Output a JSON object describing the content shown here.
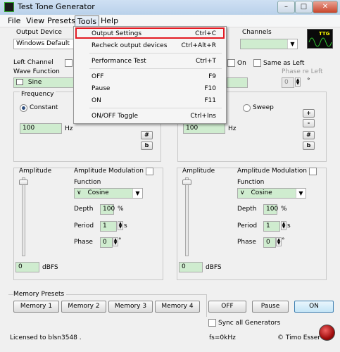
{
  "window": {
    "title": "Test Tone Generator"
  },
  "menu": {
    "file": "File",
    "view": "View",
    "presets": "Presets",
    "tools": "Tools",
    "help": "Help"
  },
  "tools_menu": [
    {
      "label": "Output Settings",
      "shortcut": "Ctrl+C"
    },
    {
      "label": "Recheck output devices",
      "shortcut": "Ctrl+Alt+R"
    },
    {
      "label": "Performance Test",
      "shortcut": "Ctrl+T"
    },
    {
      "label": "OFF",
      "shortcut": "F9"
    },
    {
      "label": "Pause",
      "shortcut": "F10"
    },
    {
      "label": "ON",
      "shortcut": "F11"
    },
    {
      "label": "ON/OFF Toggle",
      "shortcut": "Ctrl+Ins"
    }
  ],
  "output": {
    "device_label": "Output Device",
    "device_value": "Windows Default",
    "channels_label": "Channels"
  },
  "scope_text": "TTG",
  "left": {
    "channel_label": "Left Channel",
    "wave_function_label": "Wave Function",
    "wave_value": "Sine",
    "frequency_label": "Frequency",
    "constant_label": "Constant",
    "freq_value": "100",
    "freq_unit": "Hz",
    "sharp": "#",
    "flat": "b",
    "amplitude_label": "Amplitude",
    "amp_value": "0",
    "amp_unit": "dBFS",
    "am_label": "Amplitude Modulation",
    "function_label": "Function",
    "function_value": "Cosine",
    "depth_label": "Depth",
    "depth_value": "100",
    "depth_unit": "%",
    "period_label": "Period",
    "period_value": "1",
    "period_unit": "s",
    "phase_label": "Phase",
    "phase_value": "0",
    "phase_unit": "°"
  },
  "right": {
    "on_label": "On",
    "same_as_left_label": "Same as Left",
    "phase_re_left_label": "Phase re Left",
    "phase_re_left_value": "0",
    "phase_re_left_unit": "°",
    "sweep_label": "Sweep",
    "freq_value": "100",
    "freq_unit": "Hz",
    "plus": "+",
    "minus": "-",
    "sharp": "#",
    "flat": "b",
    "amplitude_label": "Amplitude",
    "amp_value": "0",
    "amp_unit": "dBFS",
    "am_label": "Amplitude Modulation",
    "function_label": "Function",
    "function_value": "Cosine",
    "depth_label": "Depth",
    "depth_value": "100",
    "depth_unit": "%",
    "period_label": "Period",
    "period_value": "1",
    "period_unit": "s",
    "phase_label": "Phase",
    "phase_value": "0",
    "phase_unit": "°"
  },
  "memory": {
    "label": "Memory Presets",
    "buttons": [
      "Memory 1",
      "Memory 2",
      "Memory 3",
      "Memory 4"
    ]
  },
  "transport": {
    "off": "OFF",
    "pause": "Pause",
    "on": "ON"
  },
  "sync_label": "Sync all Generators",
  "status": {
    "license": "Licensed to blsn3548 .",
    "fs": "fs=0kHz",
    "author": "© Timo Esser"
  },
  "colors": {
    "highlight_border": "#e31b23",
    "field_green": "#cfeccf",
    "accent_blue": "#3c7fb1"
  }
}
